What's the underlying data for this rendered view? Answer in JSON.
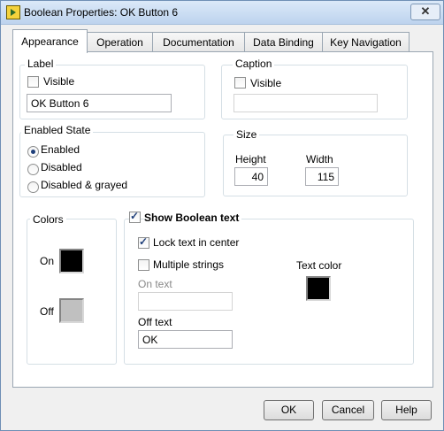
{
  "window": {
    "title": "Boolean Properties: OK Button 6",
    "close_glyph": "✕"
  },
  "tabs": [
    {
      "label": "Appearance",
      "active": true
    },
    {
      "label": "Operation"
    },
    {
      "label": "Documentation"
    },
    {
      "label": "Data Binding"
    },
    {
      "label": "Key Navigation"
    }
  ],
  "label_group": {
    "title": "Label",
    "visible_label": "Visible",
    "visible_checked": false,
    "value": "OK Button 6"
  },
  "caption_group": {
    "title": "Caption",
    "visible_label": "Visible",
    "visible_checked": false,
    "value": ""
  },
  "enabled_state": {
    "title": "Enabled State",
    "options": [
      {
        "label": "Enabled",
        "selected": true
      },
      {
        "label": "Disabled",
        "selected": false
      },
      {
        "label": "Disabled & grayed",
        "selected": false
      }
    ]
  },
  "size": {
    "title": "Size",
    "height_label": "Height",
    "height_value": "40",
    "width_label": "Width",
    "width_value": "115"
  },
  "colors": {
    "title": "Colors",
    "on_label": "On",
    "on_color": "#000000",
    "off_label": "Off",
    "off_color": "#c0c0c0"
  },
  "boolean_text": {
    "show_label": "Show Boolean text",
    "show_checked": true,
    "lock_label": "Lock text in center",
    "lock_checked": true,
    "multiple_label": "Multiple strings",
    "multiple_checked": false,
    "on_text_label": "On text",
    "on_text_value": "",
    "off_text_label": "Off text",
    "off_text_value": "OK",
    "text_color_label": "Text color",
    "text_color": "#000000"
  },
  "buttons": {
    "ok": "OK",
    "cancel": "Cancel",
    "help": "Help"
  }
}
